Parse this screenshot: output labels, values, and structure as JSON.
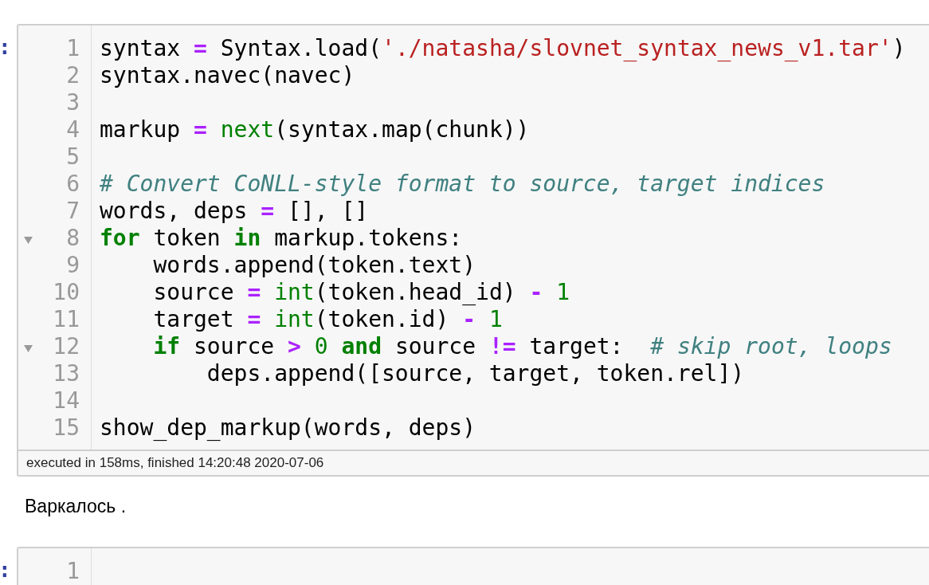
{
  "cells": [
    {
      "prompt": ":",
      "lines": [
        {
          "number": "1",
          "foldable": false,
          "tokens": [
            {
              "kind": "plain",
              "text": "syntax "
            },
            {
              "kind": "operator",
              "text": "= "
            },
            {
              "kind": "plain",
              "text": "Syntax.load("
            },
            {
              "kind": "string",
              "text": "'./natasha/slovnet_syntax_news_v1.tar'"
            },
            {
              "kind": "plain",
              "text": ")"
            }
          ]
        },
        {
          "number": "2",
          "foldable": false,
          "tokens": [
            {
              "kind": "plain",
              "text": "syntax.navec(navec)"
            }
          ]
        },
        {
          "number": "3",
          "foldable": false
        },
        {
          "number": "4",
          "foldable": false,
          "tokens": [
            {
              "kind": "plain",
              "text": "markup "
            },
            {
              "kind": "operator",
              "text": "= "
            },
            {
              "kind": "builtin",
              "text": "next"
            },
            {
              "kind": "plain",
              "text": "(syntax.map(chunk))"
            }
          ]
        },
        {
          "number": "5",
          "foldable": false
        },
        {
          "number": "6",
          "foldable": false,
          "tokens": [
            {
              "kind": "comment",
              "text": "# Convert CoNLL-style format to source, target indices"
            }
          ]
        },
        {
          "number": "7",
          "foldable": false,
          "tokens": [
            {
              "kind": "plain",
              "text": "words, deps "
            },
            {
              "kind": "operator",
              "text": "= "
            },
            {
              "kind": "plain",
              "text": "[], []"
            }
          ]
        },
        {
          "number": "8",
          "foldable": true,
          "tokens": [
            {
              "kind": "keyword",
              "text": "for"
            },
            {
              "kind": "plain",
              "text": " token "
            },
            {
              "kind": "keyword",
              "text": "in"
            },
            {
              "kind": "plain",
              "text": " markup.tokens:"
            }
          ]
        },
        {
          "number": "9",
          "foldable": false,
          "tokens": [
            {
              "kind": "plain",
              "text": "    words.append(token.text)"
            }
          ]
        },
        {
          "number": "10",
          "foldable": false,
          "tokens": [
            {
              "kind": "plain",
              "text": "    source "
            },
            {
              "kind": "operator",
              "text": "= "
            },
            {
              "kind": "builtin",
              "text": "int"
            },
            {
              "kind": "plain",
              "text": "(token.head_id) "
            },
            {
              "kind": "operator",
              "text": "- "
            },
            {
              "kind": "number",
              "text": "1"
            }
          ]
        },
        {
          "number": "11",
          "foldable": false,
          "tokens": [
            {
              "kind": "plain",
              "text": "    target "
            },
            {
              "kind": "operator",
              "text": "= "
            },
            {
              "kind": "builtin",
              "text": "int"
            },
            {
              "kind": "plain",
              "text": "(token.id) "
            },
            {
              "kind": "operator",
              "text": "- "
            },
            {
              "kind": "number",
              "text": "1"
            }
          ]
        },
        {
          "number": "12",
          "foldable": true,
          "tokens": [
            {
              "kind": "keyword",
              "text": "    if"
            },
            {
              "kind": "plain",
              "text": " source "
            },
            {
              "kind": "operator",
              "text": "> "
            },
            {
              "kind": "number",
              "text": "0"
            },
            {
              "kind": "keyword",
              "text": " and"
            },
            {
              "kind": "plain",
              "text": " source "
            },
            {
              "kind": "operator",
              "text": "!= "
            },
            {
              "kind": "plain",
              "text": "target:  "
            },
            {
              "kind": "comment",
              "text": "# skip root, loops"
            }
          ]
        },
        {
          "number": "13",
          "foldable": false,
          "tokens": [
            {
              "kind": "plain",
              "text": "        deps.append([source, target, token.rel])"
            }
          ]
        },
        {
          "number": "14",
          "foldable": false
        },
        {
          "number": "15",
          "foldable": false,
          "tokens": [
            {
              "kind": "plain",
              "text": "show_dep_markup(words, deps)"
            }
          ]
        }
      ],
      "footer": "executed in 158ms, finished 14:20:48 2020-07-06",
      "output": "Варкалось ."
    },
    {
      "prompt": ":",
      "lines": [
        {
          "number": "1",
          "foldable": false
        }
      ]
    }
  ]
}
